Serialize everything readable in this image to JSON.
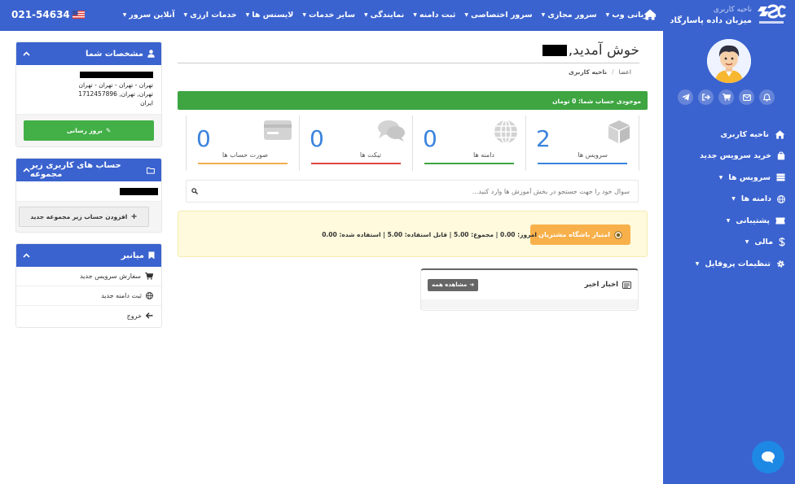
{
  "topbar": {
    "phone": "021-54634",
    "brand": {
      "subtitle": "ناحیه کاربری",
      "name": "میزبان داده پاسارگاد"
    },
    "nav": [
      {
        "label": "میزبانی وب",
        "dropdown": true
      },
      {
        "label": "سرور مجازی",
        "dropdown": true
      },
      {
        "label": "سرور اختصاصی",
        "dropdown": true
      },
      {
        "label": "ثبت دامنه",
        "dropdown": true
      },
      {
        "label": "نمایندگی",
        "dropdown": true
      },
      {
        "label": "سایر خدمات",
        "dropdown": true
      },
      {
        "label": "لایسنس ها",
        "dropdown": true
      },
      {
        "label": "خدمات ارزی",
        "dropdown": true
      },
      {
        "label": "آنلاین سرور",
        "dropdown": true
      }
    ]
  },
  "sidebar": {
    "items": [
      {
        "label": "ناحیه کاربری",
        "icon": "home-icon",
        "dropdown": false
      },
      {
        "label": "خرید سرویس جدید",
        "icon": "bag-icon",
        "dropdown": false
      },
      {
        "label": "سرویس ها",
        "icon": "server-icon",
        "dropdown": true
      },
      {
        "label": "دامنه ها",
        "icon": "globe-icon",
        "dropdown": true
      },
      {
        "label": "پشتیبانی",
        "icon": "ticket-icon",
        "dropdown": true
      },
      {
        "label": "مالی",
        "icon": "dollar-icon",
        "dropdown": true
      },
      {
        "label": "تنظیمات پروفایل",
        "icon": "gear-icon",
        "dropdown": true
      }
    ]
  },
  "main": {
    "welcome": "خوش آمدید,",
    "breadcrumb": [
      "اعضا",
      "ناحیه کاربری"
    ],
    "balance": "موجودی حساب شما: 0 تومان",
    "stats": [
      {
        "label": "سرویس ها",
        "value": "2",
        "icon": "cube-icon",
        "color": "#3b83dd"
      },
      {
        "label": "دامنه ها",
        "value": "0",
        "icon": "globe-icon",
        "color": "#3ea541"
      },
      {
        "label": "تیکت ها",
        "value": "0",
        "icon": "comments-icon",
        "color": "#e04343"
      },
      {
        "label": "صورت حساب ها",
        "value": "0",
        "icon": "card-icon",
        "color": "#f0ad4e"
      }
    ],
    "search_placeholder": "سوال خود را جهت جستجو در بخش آموزش ها وارد کنید...",
    "club": {
      "button": "امتیاز باشگاه مشتریان",
      "stats": "امروز: 0.00 | مجموع: 5.00 | قابل استفاده: 5.00 | استفاده شده: 0.00"
    },
    "news": {
      "title": "اخبار اخیر",
      "view_all": "مشاهده همه"
    }
  },
  "left": {
    "profile": {
      "title": "مشخصات شما",
      "address": [
        "تهران - تهران - تهران - تهران",
        "تهران, تهران, 1712457896",
        "ایران"
      ],
      "update_button": "بروز رسانی"
    },
    "subaccounts": {
      "title": "حساب های کاربری زیر مجموعه",
      "add_button": "افزودن حساب زیر مجموعه جدید"
    },
    "shortcuts": {
      "title": "میانبر",
      "items": [
        {
          "label": "سفارش سرویس جدید",
          "icon": "cart-icon"
        },
        {
          "label": "ثبت دامنه جدید",
          "icon": "globe-icon"
        },
        {
          "label": "خروج",
          "icon": "arrow-left-icon"
        }
      ]
    }
  },
  "colors": {
    "primary": "#3b63cf",
    "success": "#3ea541",
    "accent": "#3b83dd",
    "warning": "#f8b04a"
  }
}
